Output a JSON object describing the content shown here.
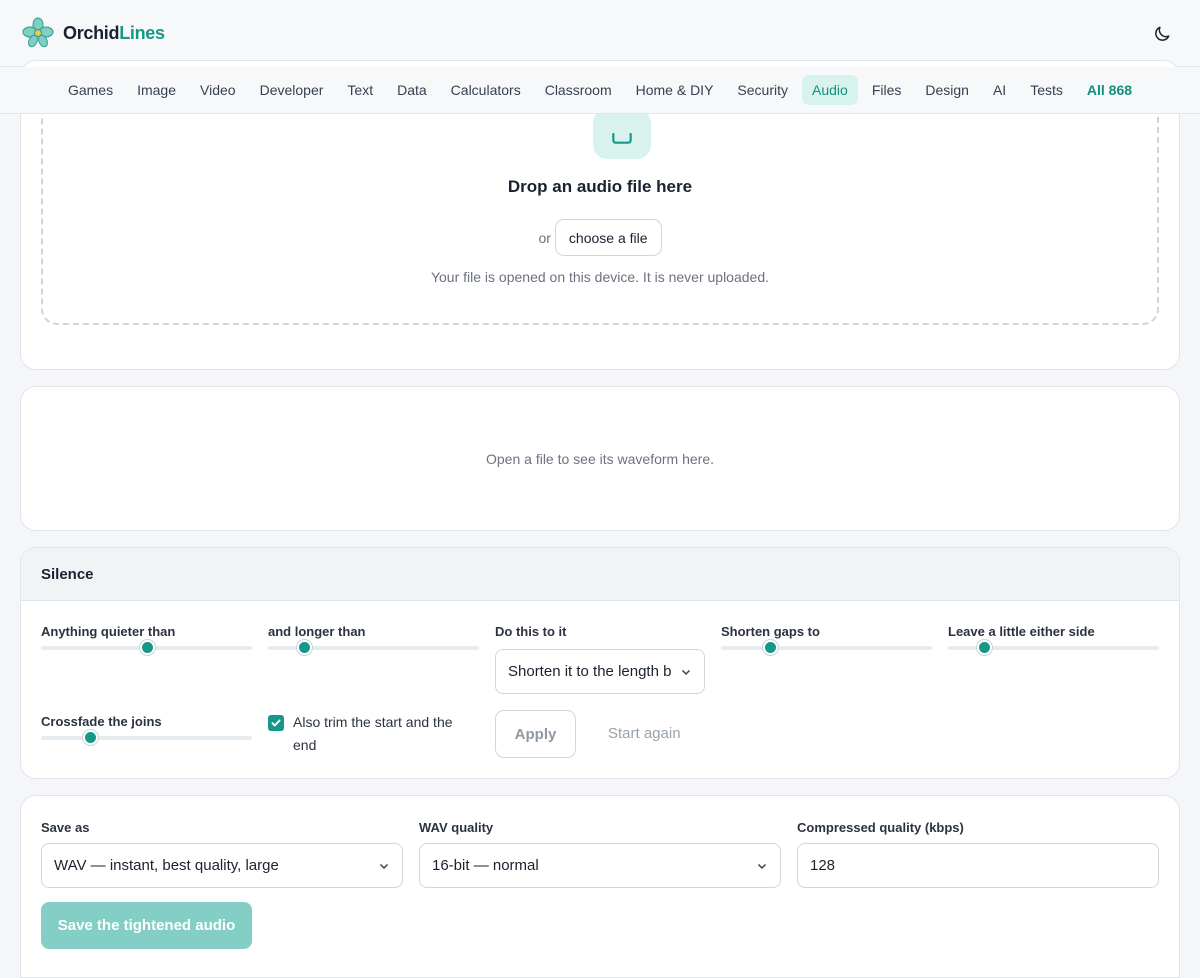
{
  "brand": {
    "name_part1": "Orchid",
    "name_part2": "Lines"
  },
  "nav": {
    "items": [
      "Games",
      "Image",
      "Video",
      "Developer",
      "Text",
      "Data",
      "Calculators",
      "Classroom",
      "Home & DIY",
      "Security",
      "Audio",
      "Files",
      "Design",
      "AI",
      "Tests"
    ],
    "active": "Audio",
    "all_label": "All 868"
  },
  "dropzone": {
    "title": "Drop an audio file here",
    "or": "or",
    "choose_label": "choose a file",
    "note": "Your file is opened on this device. It is never uploaded."
  },
  "waveform": {
    "placeholder": "Open a file to see its waveform here."
  },
  "silence": {
    "title": "Silence",
    "threshold": {
      "label": "Anything quieter than",
      "level": 0.5
    },
    "min_length": {
      "label": "and longer than",
      "level": 0.17
    },
    "action": {
      "label": "Do this to it",
      "value": "Shorten it to the length below"
    },
    "shorten_to": {
      "label": "Shorten gaps to",
      "level": 0.23
    },
    "padding": {
      "label": "Leave a little either side",
      "level": 0.17
    },
    "crossfade": {
      "label": "Crossfade the joins",
      "level": 0.23
    },
    "trim": {
      "label": "Also trim the start and the end",
      "checked": true
    },
    "apply_label": "Apply",
    "reset_label": "Start again"
  },
  "save": {
    "format": {
      "label": "Save as",
      "value": "WAV — instant, best quality, large"
    },
    "wav_quality": {
      "label": "WAV quality",
      "value": "16-bit — normal"
    },
    "bitrate": {
      "label": "Compressed quality (kbps)",
      "value": "128"
    },
    "button_label": "Save the tightened audio"
  },
  "colors": {
    "accent": "#15978a",
    "accent_soft": "#d8f3ee",
    "disabled_button": "#84cfc5"
  },
  "icons": {
    "theme_toggle": "moon-icon",
    "upload": "file-icon",
    "logo": "orchid-icon"
  }
}
